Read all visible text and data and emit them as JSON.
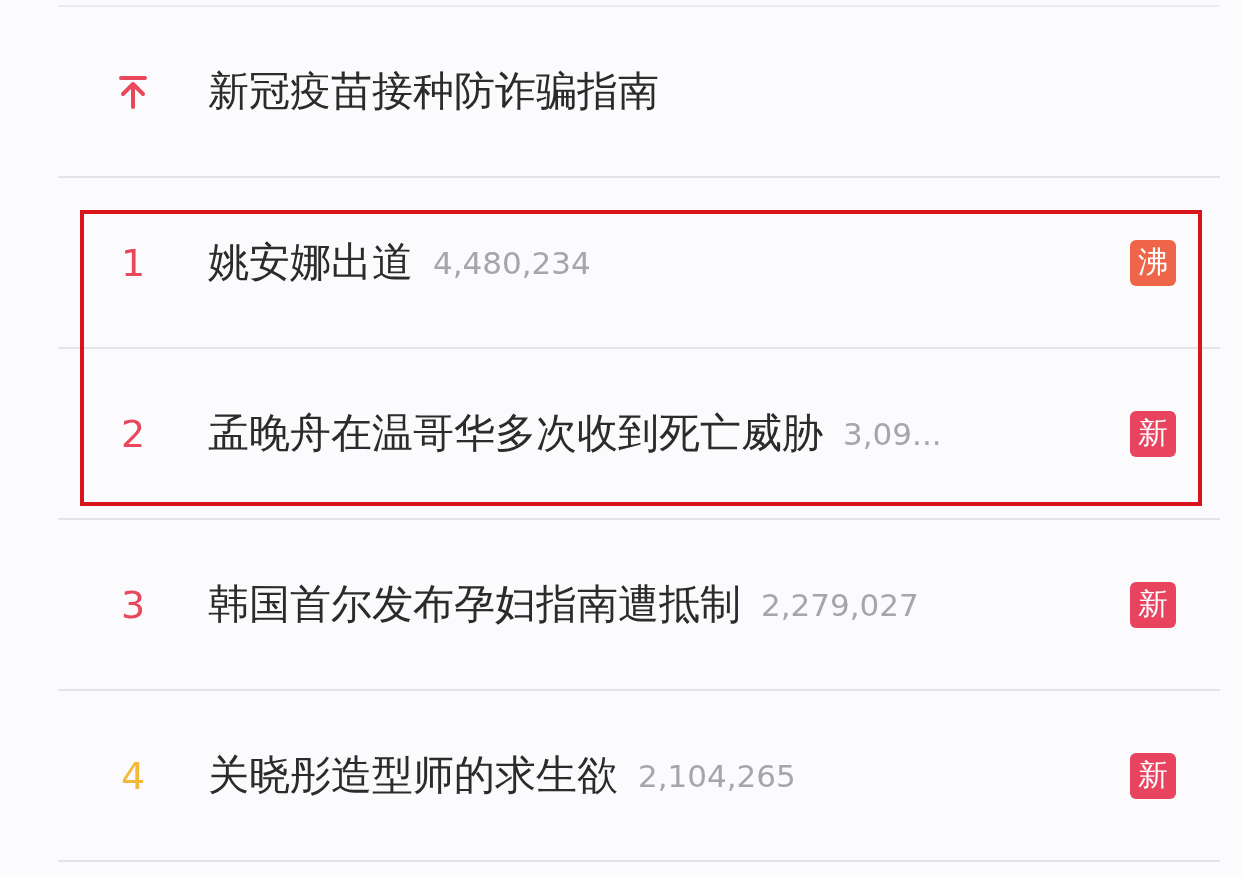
{
  "pinned": {
    "title": "新冠疫苗接种防诈骗指南"
  },
  "rows": [
    {
      "rank": "1",
      "color": "#e9485c",
      "title": "姚安娜出道",
      "count": "4,480,234",
      "badge": {
        "kind": "boil",
        "text": "沸"
      },
      "highlighted": true
    },
    {
      "rank": "2",
      "color": "#e9485c",
      "title": "孟晚舟在温哥华多次收到死亡威胁",
      "count": "3,09...",
      "badge": {
        "kind": "new",
        "text": "新"
      },
      "highlighted": true
    },
    {
      "rank": "3",
      "color": "#e9485c",
      "title": "韩国首尔发布孕妇指南遭抵制",
      "count": "2,279,027",
      "badge": {
        "kind": "new",
        "text": "新"
      },
      "highlighted": false
    },
    {
      "rank": "4",
      "color": "#f4b93a",
      "title": "关晓彤造型师的求生欲",
      "count": "2,104,265",
      "badge": {
        "kind": "new",
        "text": "新"
      },
      "highlighted": false
    }
  ]
}
